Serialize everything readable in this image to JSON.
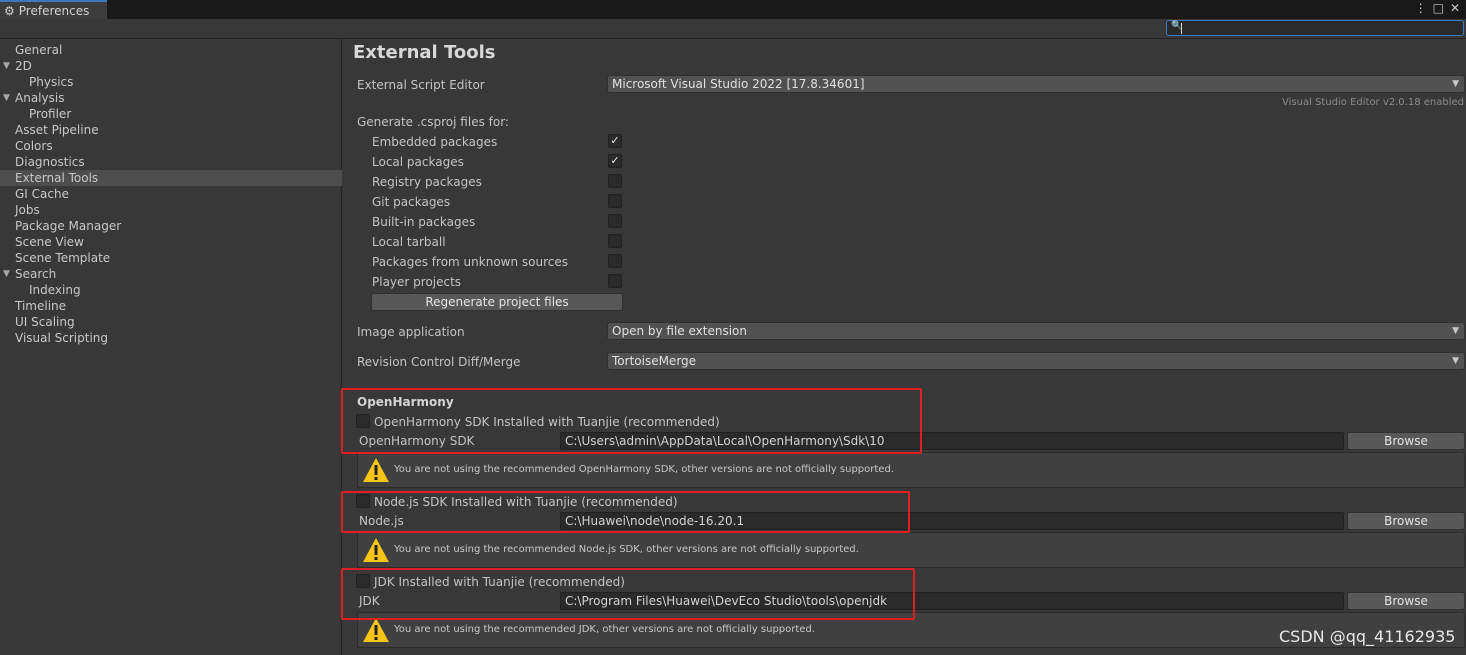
{
  "window": {
    "tab_title": "Preferences",
    "menu_icon": "kebab-menu-icon",
    "maximize_icon": "maximize-icon",
    "close_icon": "close-icon"
  },
  "search": {
    "placeholder": ""
  },
  "sidebar": {
    "items": [
      {
        "label": "General"
      },
      {
        "label": "2D"
      },
      {
        "label": "Physics"
      },
      {
        "label": "Analysis"
      },
      {
        "label": "Profiler"
      },
      {
        "label": "Asset Pipeline"
      },
      {
        "label": "Colors"
      },
      {
        "label": "Diagnostics"
      },
      {
        "label": "External Tools"
      },
      {
        "label": "GI Cache"
      },
      {
        "label": "Jobs"
      },
      {
        "label": "Package Manager"
      },
      {
        "label": "Scene View"
      },
      {
        "label": "Scene Template"
      },
      {
        "label": "Search"
      },
      {
        "label": "Indexing"
      },
      {
        "label": "Timeline"
      },
      {
        "label": "UI Scaling"
      },
      {
        "label": "Visual Scripting"
      }
    ]
  },
  "main": {
    "title": "External Tools",
    "script_editor": {
      "label": "External Script Editor",
      "value": "Microsoft Visual Studio 2022 [17.8.34601]",
      "note": "Visual Studio Editor v2.0.18 enabled"
    },
    "csproj": {
      "label": "Generate .csproj files for:",
      "options": [
        {
          "label": "Embedded packages",
          "checked": true
        },
        {
          "label": "Local packages",
          "checked": true
        },
        {
          "label": "Registry packages",
          "checked": false
        },
        {
          "label": "Git packages",
          "checked": false
        },
        {
          "label": "Built-in packages",
          "checked": false
        },
        {
          "label": "Local tarball",
          "checked": false
        },
        {
          "label": "Packages from unknown sources",
          "checked": false
        },
        {
          "label": "Player projects",
          "checked": false
        }
      ],
      "check_mark": "✓",
      "regenerate_label": "Regenerate project files"
    },
    "image_app": {
      "label": "Image application",
      "value": "Open by file extension"
    },
    "revision": {
      "label": "Revision Control Diff/Merge",
      "value": "TortoiseMerge"
    },
    "openharmony": {
      "section_title": "OpenHarmony",
      "sdk_toggle": "OpenHarmony SDK Installed with Tuanjie (recommended)",
      "sdk_label": "OpenHarmony SDK",
      "sdk_path": "C:\\Users\\admin\\AppData\\Local\\OpenHarmony\\Sdk\\10",
      "sdk_warning": "You are not using the recommended OpenHarmony SDK, other versions are not officially supported.",
      "node_toggle": "Node.js SDK Installed with Tuanjie (recommended)",
      "node_label": "Node.js",
      "node_path": "C:\\Huawei\\node\\node-16.20.1",
      "node_warning": "You are not using the recommended Node.js SDK, other versions are not officially supported.",
      "jdk_toggle": "JDK Installed with Tuanjie (recommended)",
      "jdk_label": "JDK",
      "jdk_path": "C:\\Program Files\\Huawei\\DevEco Studio\\tools\\openjdk",
      "jdk_warning": "You are not using the recommended JDK, other versions are not officially supported.",
      "browse_label": "Browse"
    }
  },
  "watermark": "CSDN @qq_41162935",
  "colors": {
    "highlight": "#e02020",
    "accent": "#3a79bb",
    "warning": "#f5c518"
  }
}
